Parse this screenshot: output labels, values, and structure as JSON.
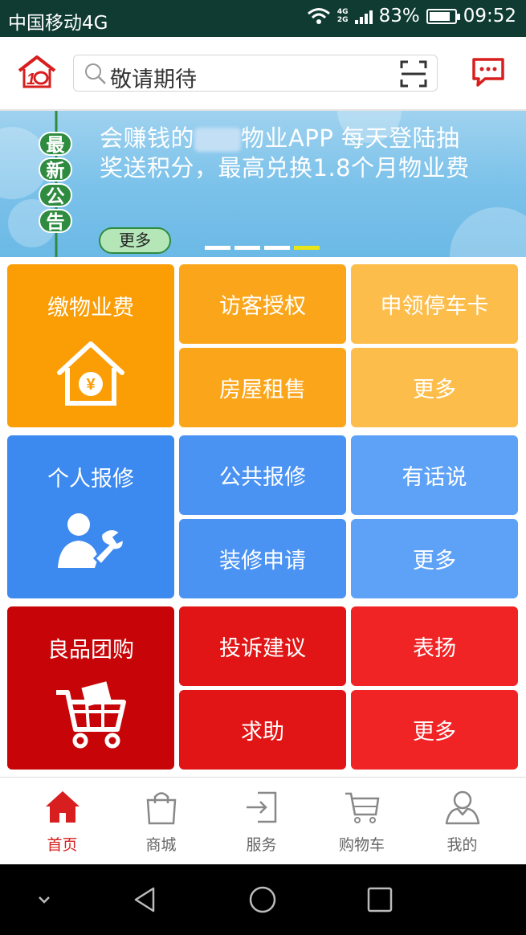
{
  "status_bar": {
    "carrier": "中国移动4G",
    "net_top": "4G",
    "net_bottom": "2G",
    "battery_percent": "83%",
    "battery_level": 0.83,
    "time": "09:52"
  },
  "header": {
    "search_placeholder": "敬请期待"
  },
  "banner": {
    "badge_chars": [
      "最",
      "新",
      "公",
      "告"
    ],
    "line1_prefix": "会赚钱的",
    "line1_suffix": "物业APP  每天登陆抽",
    "line2": "奖送积分，最高兑换1.8个月物业费",
    "more_label": "更多",
    "slide_count": 4,
    "active_slide": 4
  },
  "groups": [
    {
      "big_label": "缴物业费",
      "big_icon": "house-yen-icon",
      "color_big": "#fb9d05",
      "color_mid": "#fba61a",
      "color_right": "#fdbd4a",
      "small": [
        "访客授权",
        "申领停车卡",
        "房屋租售",
        "更多"
      ]
    },
    {
      "big_label": "个人报修",
      "big_icon": "repair-person-icon",
      "color_big": "#3c89ef",
      "color_mid": "#4b93f3",
      "color_right": "#5ea2f7",
      "small": [
        "公共报修",
        "有话说",
        "装修申请",
        "更多"
      ]
    },
    {
      "big_label": "良品团购",
      "big_icon": "shopping-cart-icon",
      "color_big": "#c70508",
      "color_mid": "#e11515",
      "color_right": "#f02325",
      "small": [
        "投诉建议",
        "表扬",
        "求助",
        "更多"
      ]
    }
  ],
  "bottom_nav": {
    "items": [
      {
        "label": "首页",
        "icon": "home-icon",
        "active": true
      },
      {
        "label": "商城",
        "icon": "shopping-bag-icon",
        "active": false
      },
      {
        "label": "服务",
        "icon": "service-login-icon",
        "active": false
      },
      {
        "label": "购物车",
        "icon": "cart-icon",
        "active": false
      },
      {
        "label": "我的",
        "icon": "user-icon",
        "active": false
      }
    ],
    "active_color": "#d81e1e"
  },
  "system_nav": {
    "icons": [
      "chevron-down-icon",
      "back-icon",
      "home-circle-icon",
      "recents-icon"
    ]
  }
}
